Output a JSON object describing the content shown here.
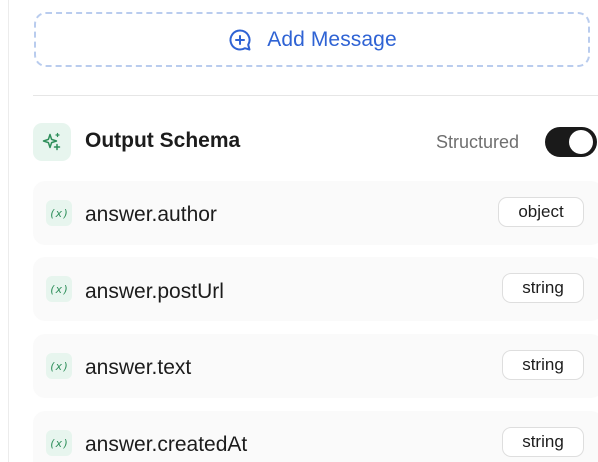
{
  "add_message": {
    "label": "Add Message",
    "icon": "message-plus-icon"
  },
  "output_schema": {
    "title": "Output Schema",
    "icon": "sparkle-icon",
    "mode_label": "Structured",
    "structured_enabled": true
  },
  "fields": [
    {
      "name": "answer.author",
      "type": "object",
      "icon": "variable-icon",
      "icon_glyph": "(x)"
    },
    {
      "name": "answer.postUrl",
      "type": "string",
      "icon": "variable-icon",
      "icon_glyph": "(x)"
    },
    {
      "name": "answer.text",
      "type": "string",
      "icon": "variable-icon",
      "icon_glyph": "(x)"
    },
    {
      "name": "answer.createdAt",
      "type": "string",
      "icon": "variable-icon",
      "icon_glyph": "(x)"
    }
  ],
  "colors": {
    "accent": "#2f63d4",
    "accent_dashed_border": "#b9ccee",
    "schema_icon_bg": "#e7f5ee",
    "schema_icon_fg": "#2f8f5b",
    "toggle_on": "#1a1a1a"
  }
}
